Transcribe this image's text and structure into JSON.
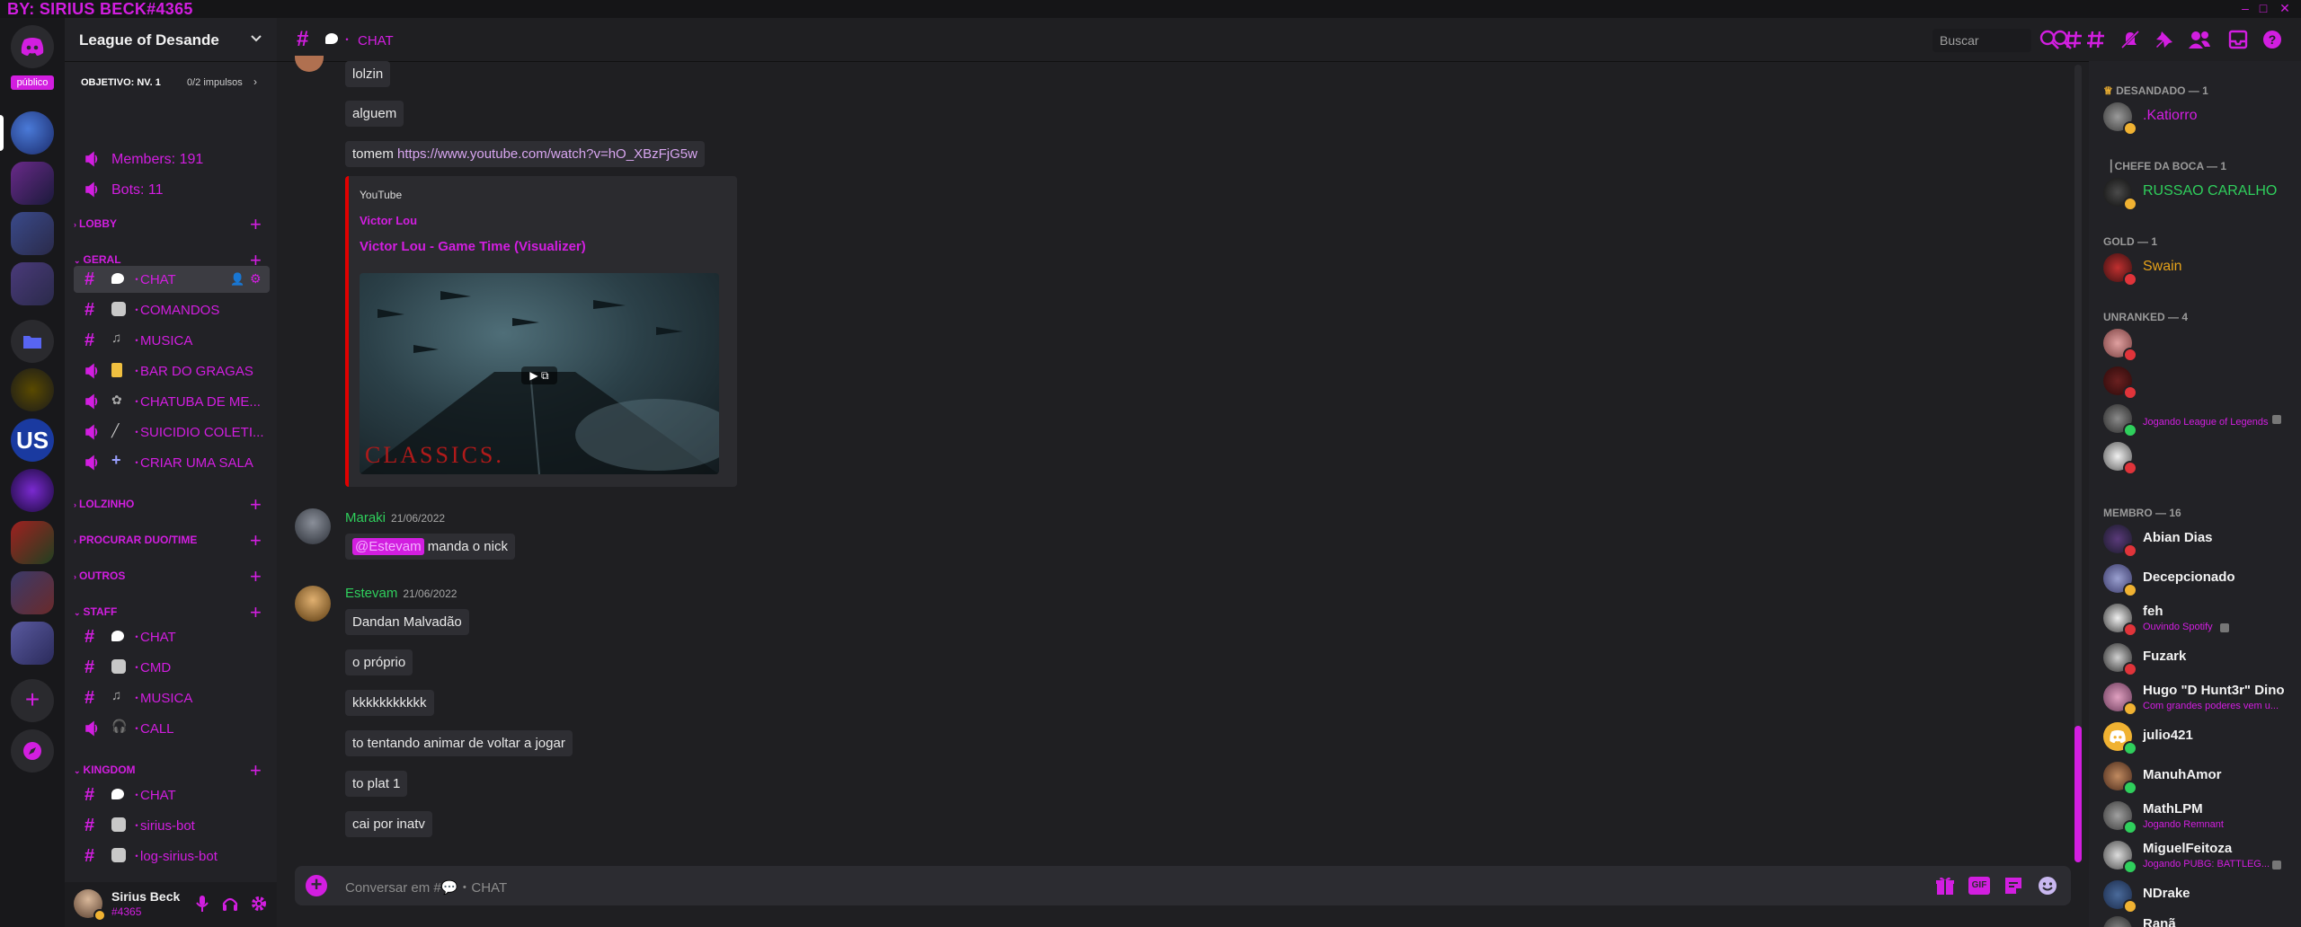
{
  "app": {
    "brand": "BY: SIRIUS BECK#4365",
    "public_badge": "público"
  },
  "server": {
    "name": "League of Desande",
    "boost_label": "OBJETIVO: NV. 1",
    "boost_progress": "0/2 impulsos",
    "boost_progress_fraction": 0
  },
  "stats": [
    {
      "label": "Members: 191"
    },
    {
      "label": "Bots: 11"
    }
  ],
  "categories": {
    "lobby": "LOBBY",
    "geral": "GERAL",
    "lolzinho": "LOLZINHO",
    "procurar": "PROCURAR DUO/TIME",
    "outros": "OUTROS",
    "staff": "STAFF",
    "kingdom": "KINGDOM"
  },
  "geral_channels": [
    {
      "label": "CHAT",
      "type": "text",
      "icon": "speech-bubble-icon"
    },
    {
      "label": "COMANDOS",
      "type": "text",
      "icon": "robot-icon"
    },
    {
      "label": "MUSICA",
      "type": "text",
      "icon": "music-note-icon"
    },
    {
      "label": "BAR DO GRAGAS",
      "type": "voice",
      "icon": "beer-icon"
    },
    {
      "label": "CHATUBA DE ME...",
      "type": "voice",
      "icon": "dance-icon"
    },
    {
      "label": "SUICIDIO COLETI...",
      "type": "voice",
      "icon": "knife-icon"
    },
    {
      "label": "CRIAR UMA SALA",
      "type": "voice",
      "icon": "plus-icon"
    }
  ],
  "staff_channels": [
    {
      "label": "CHAT",
      "type": "text",
      "icon": "speech-bubble-icon"
    },
    {
      "label": "CMD",
      "type": "text",
      "icon": "robot-icon"
    },
    {
      "label": "MUSICA",
      "type": "text",
      "icon": "music-note-icon"
    },
    {
      "label": "CALL",
      "type": "voice",
      "icon": "headphones-icon"
    }
  ],
  "kingdom_channels": [
    {
      "label": "CHAT",
      "type": "text",
      "icon": "speech-bubble-icon"
    },
    {
      "label": "sirius-bot",
      "type": "text",
      "icon": "robot-icon"
    },
    {
      "label": "log-sirius-bot",
      "type": "text",
      "icon": "robot-icon"
    }
  ],
  "user": {
    "name": "Sirius Beck",
    "tag": "#4365"
  },
  "header": {
    "channel": "CHAT",
    "search_placeholder": "Buscar"
  },
  "messages": {
    "top": [
      "lolzin",
      "alguem"
    ],
    "link_prefix": "tomem ",
    "link": "https://www.youtube.com/watch?v=hO_XBzFjG5w",
    "embed": {
      "provider": "YouTube",
      "author": "Victor Lou",
      "title": "Victor Lou - Game Time (Visualizer)",
      "thumb_text": "CLASSICS."
    },
    "maraki": {
      "author": "Maraki",
      "date": "21/06/2022",
      "mention": "@Estevam",
      "text": " manda o nick"
    },
    "estevam": {
      "author": "Estevam",
      "date": "21/06/2022",
      "lines": [
        "Dandan Malvadão",
        "o próprio",
        "kkkkkkkkkkk",
        "to tentando animar de voltar a jogar",
        "to plat 1",
        "cai por inatv"
      ]
    }
  },
  "composer": {
    "placeholder": "Conversar em #💬・CHAT"
  },
  "members": {
    "groups": [
      {
        "title": "DESANDADO — 1"
      },
      {
        "title": "CHEFE DA BOCA — 1"
      },
      {
        "title": "GOLD — 1"
      },
      {
        "title": "UNRANKED — 4"
      },
      {
        "title": "MEMBRO — 16"
      }
    ],
    "desandado": [
      {
        "name": ".Katiorro",
        "color": "#d21ee0"
      }
    ],
    "chefe": [
      {
        "name": "RUSSAO CARALHO",
        "color": "#2fcf5c"
      }
    ],
    "gold": [
      {
        "name": "Swain",
        "color": "#e6a21a"
      }
    ],
    "unranked": [
      {
        "name": "",
        "activity": ""
      },
      {
        "name": "",
        "activity": ""
      },
      {
        "name": "",
        "activity": "Jogando League of Legends"
      },
      {
        "name": "",
        "activity": ""
      }
    ],
    "membro": [
      {
        "name": "Abian Dias",
        "activity": ""
      },
      {
        "name": "Decepcionado",
        "activity": ""
      },
      {
        "name": "feh",
        "activity": "Ouvindo Spotify"
      },
      {
        "name": "Fuzark",
        "activity": ""
      },
      {
        "name": "Hugo \"D Hunt3r\" Dino",
        "activity": "Com grandes poderes vem u..."
      },
      {
        "name": "julio421",
        "activity": ""
      },
      {
        "name": "ManuhAmor",
        "activity": ""
      },
      {
        "name": "MathLPM",
        "activity": "Jogando Remnant"
      },
      {
        "name": "MiguelFeitoza",
        "activity": "Jogando PUBG: BATTLEG..."
      },
      {
        "name": "NDrake",
        "activity": ""
      },
      {
        "name": "Ranã",
        "activity": ""
      }
    ]
  },
  "colors": {
    "accent": "#d21ee0",
    "online": "#2fcf5c",
    "dnd": "#e0343a",
    "idle": "#f0b232"
  }
}
